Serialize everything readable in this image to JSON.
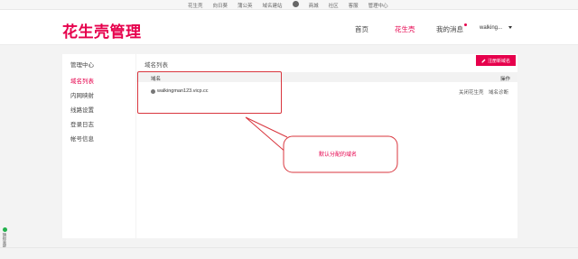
{
  "topbar": {
    "links": [
      "花生壳",
      "向日葵",
      "蒲公英",
      "域名建站",
      "商城",
      "社区",
      "客服",
      "管理中心"
    ]
  },
  "header": {
    "logo": "花生壳管理",
    "nav": {
      "home": "首页",
      "hsk": "花生壳",
      "messages": "我的消息",
      "user": "walking..."
    }
  },
  "sidebar": {
    "items": [
      {
        "label": "管理中心"
      },
      {
        "label": "域名列表"
      },
      {
        "label": "内网映射"
      },
      {
        "label": "线路设置"
      },
      {
        "label": "登录日志"
      },
      {
        "label": "帐号信息"
      }
    ]
  },
  "main": {
    "title": "域名列表",
    "register_button": "注册新域名",
    "table": {
      "col_domain": "域名",
      "col_action": "操作",
      "rows": [
        {
          "domain": "walkingman123.vicp.cc",
          "action_close": "关闭花生壳",
          "action_diag": "域名诊断"
        }
      ]
    }
  },
  "annotation": {
    "callout_text": "默认分配的域名",
    "color": "#d9363e"
  },
  "side_widget": {
    "text": "猜你喜欢"
  },
  "colors": {
    "brand": "#e6004c"
  }
}
